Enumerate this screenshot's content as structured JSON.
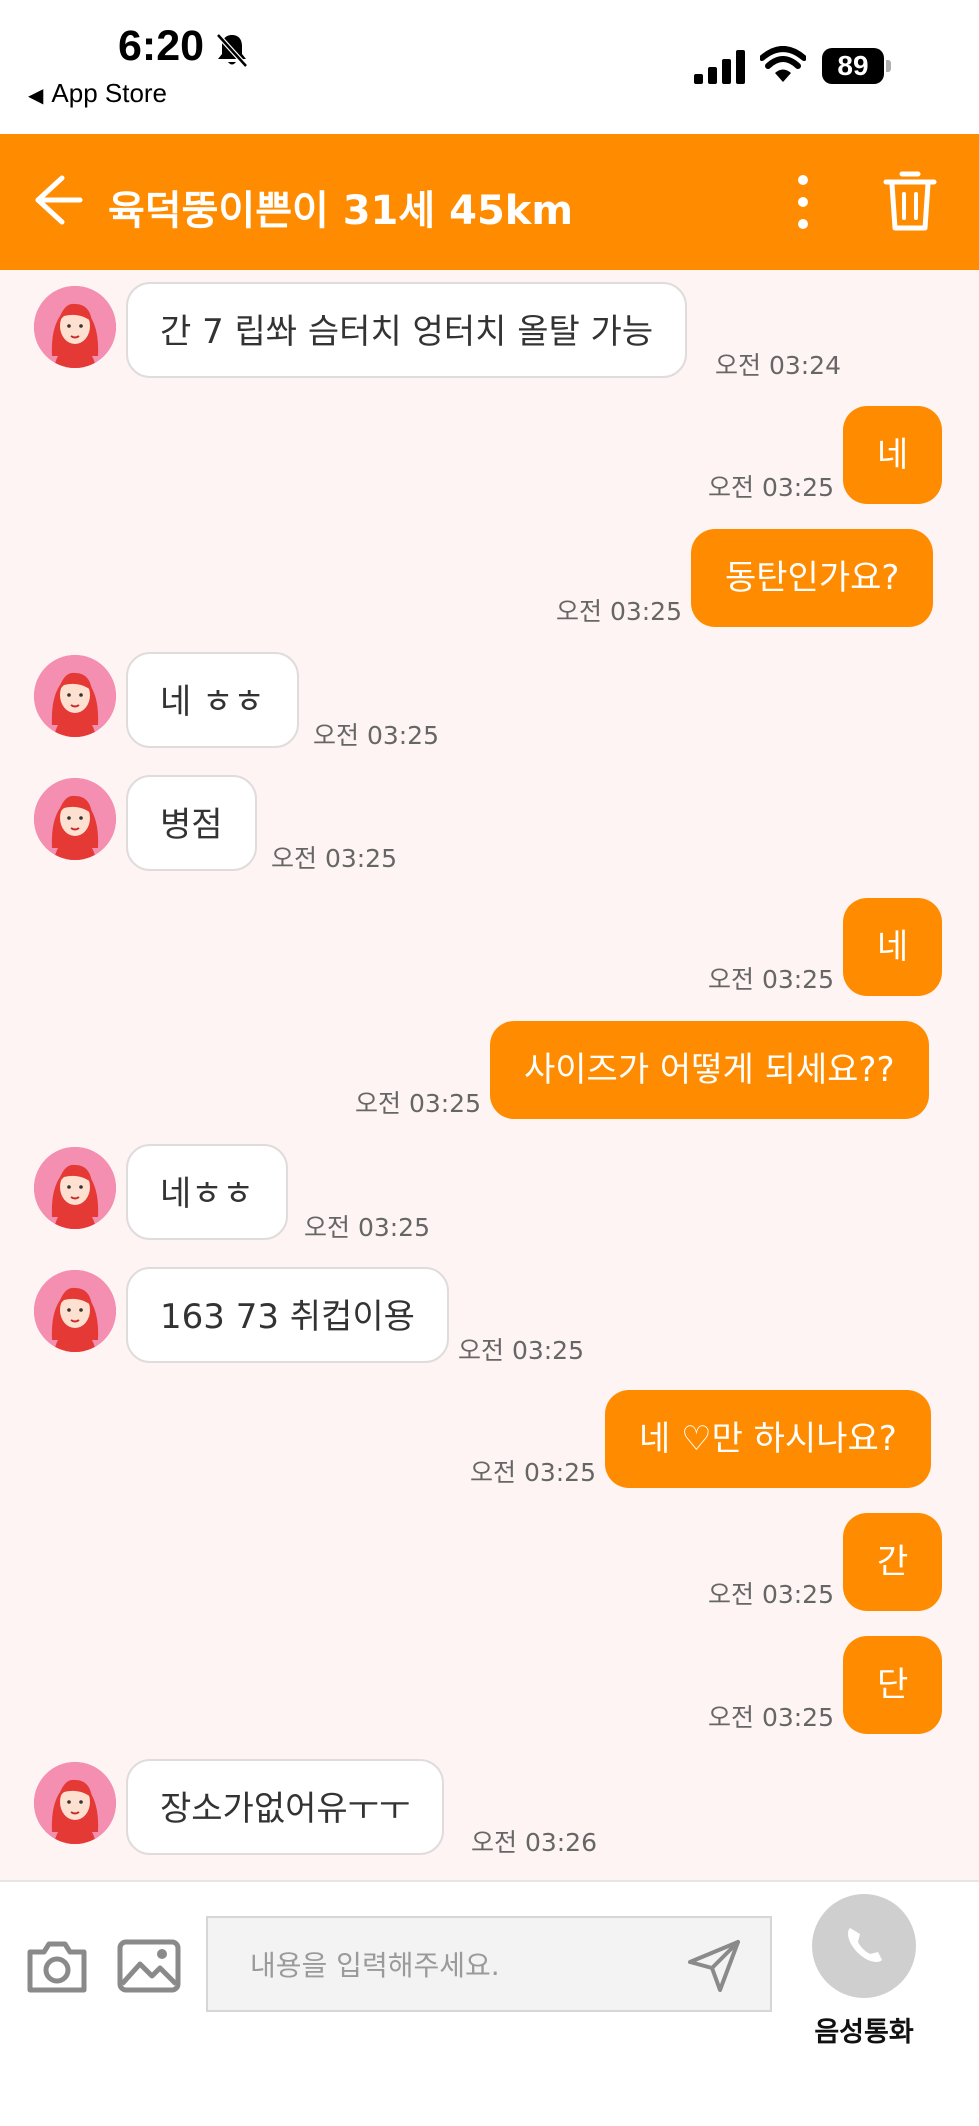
{
  "status_bar": {
    "time": "6:20",
    "back_app": "App Store",
    "battery": "89"
  },
  "header": {
    "title": "육덕뚱이쁜이 31세 45km"
  },
  "messages": [
    {
      "side": "in",
      "text": "간  7 립쏴 슴터치 엉터치 올탈 가능",
      "time": "오전 03:24"
    },
    {
      "side": "out",
      "text": "네",
      "time": "오전 03:25"
    },
    {
      "side": "out",
      "text": "동탄인가요?",
      "time": "오전 03:25"
    },
    {
      "side": "in",
      "text": "네 ㅎㅎ",
      "time": "오전 03:25"
    },
    {
      "side": "in",
      "text": "병점",
      "time": "오전 03:25"
    },
    {
      "side": "out",
      "text": "네",
      "time": "오전 03:25"
    },
    {
      "side": "out",
      "text": "사이즈가 어떻게 되세요??",
      "time": "오전 03:25"
    },
    {
      "side": "in",
      "text": "네ㅎㅎ",
      "time": "오전 03:25"
    },
    {
      "side": "in",
      "text": "163 73 취컵이용",
      "time": "오전 03:25"
    },
    {
      "side": "out",
      "text": "네 ♡만 하시나요?",
      "time": "오전 03:25"
    },
    {
      "side": "out",
      "text": "간",
      "time": "오전 03:25"
    },
    {
      "side": "out",
      "text": "단",
      "time": "오전 03:25"
    },
    {
      "side": "in",
      "text": "장소가없어유ㅜㅜ",
      "time": "오전 03:26"
    }
  ],
  "input": {
    "placeholder": "내용을 입력해주세요.",
    "voice_call_label": "음성통화"
  },
  "icons": {
    "back": "back-arrow-icon",
    "more": "more-vertical-icon",
    "trash": "trash-icon",
    "camera": "camera-icon",
    "gallery": "image-icon",
    "send": "send-icon",
    "phone": "phone-icon"
  },
  "colors": {
    "accent": "#ff8c00",
    "chat_background": "#fdf4f3",
    "avatar": "#f06292"
  }
}
